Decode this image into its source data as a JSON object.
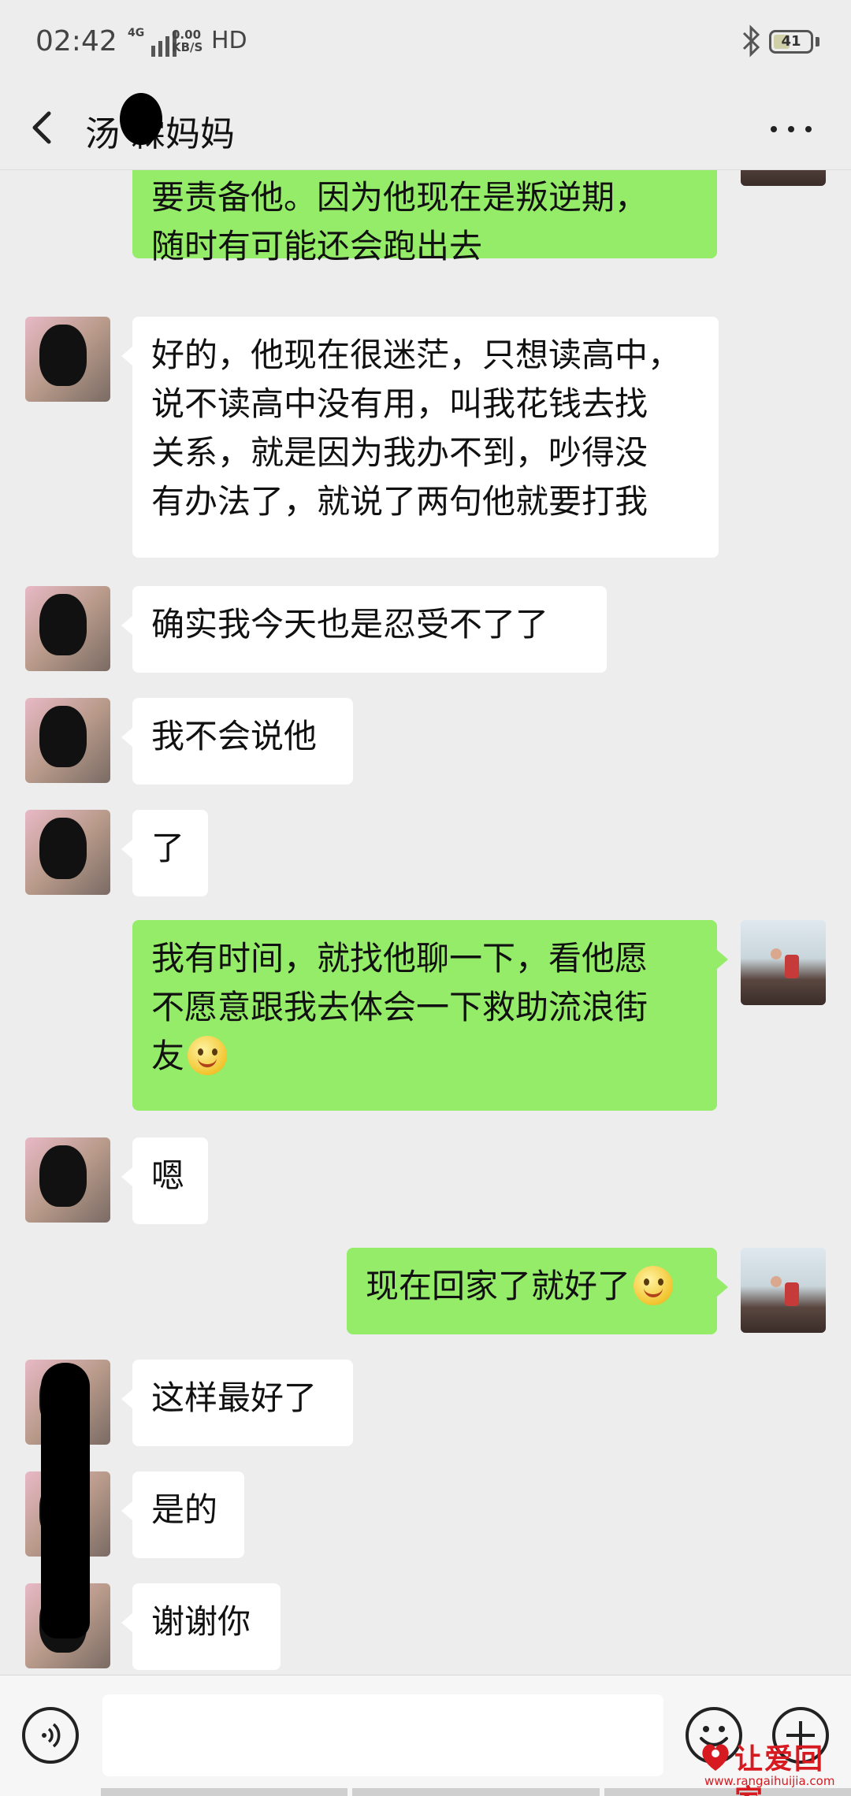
{
  "status_bar": {
    "time": "02:42",
    "network_type": "4G",
    "speed_value": "0.00",
    "speed_unit": "KB/S",
    "hd": "HD",
    "battery": "41"
  },
  "header": {
    "title": "汤  霖妈妈"
  },
  "messages": [
    {
      "side": "right",
      "text": "要责备他。因为他现在是叛逆期，\n随时有可能还会跑出去"
    },
    {
      "side": "left",
      "text": "好的，他现在很迷茫，只想读高中，\n说不读高中没有用，叫我花钱去找\n关系，就是因为我办不到，吵得没\n有办法了，就说了两句他就要打我"
    },
    {
      "side": "left",
      "text": "确实我今天也是忍受不了了"
    },
    {
      "side": "left",
      "text": "我不会说他"
    },
    {
      "side": "left",
      "text": "了"
    },
    {
      "side": "right",
      "text": "我有时间，就找他聊一下，看他愿\n不愿意跟我去体会一下救助流浪街\n友"
    },
    {
      "side": "left",
      "text": "嗯"
    },
    {
      "side": "right",
      "text": "现在回家了就好了"
    },
    {
      "side": "left",
      "text": "这样最好了"
    },
    {
      "side": "left",
      "text": "是的"
    },
    {
      "side": "left",
      "text": "谢谢你"
    }
  ],
  "input": {
    "value": ""
  },
  "icons": {
    "back": "chevron-left-icon",
    "more": "more-dots-icon",
    "voice": "voice-icon",
    "emoji": "emoji-icon",
    "plus": "plus-icon",
    "smiley": "smiley-emoji"
  },
  "watermark": {
    "text": "让爱回家",
    "url": "www.rangaihuijia.com"
  },
  "colors": {
    "background": "#ededed",
    "bubble_mine": "#95ec69",
    "bubble_other": "#ffffff",
    "watermark": "#d71920"
  }
}
